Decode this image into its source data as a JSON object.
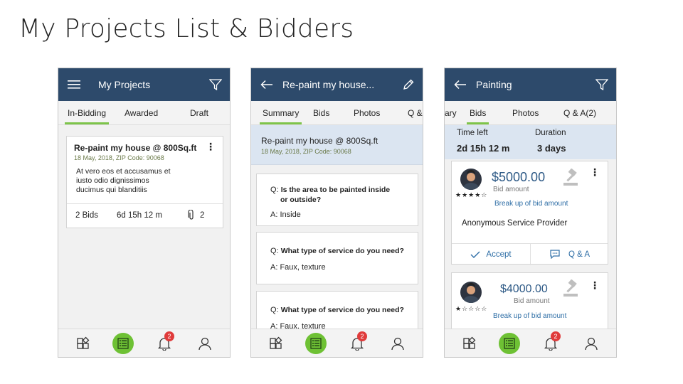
{
  "slide": {
    "title": "My Projects List & Bidders"
  },
  "screen1": {
    "appbar_title": "My Projects",
    "tabs": [
      "In-Bidding",
      "Awarded",
      "Draft"
    ],
    "card": {
      "title": "Re-paint  my house @ 800Sq.ft",
      "meta": "18 May, 2018, ZIP Code: 90068",
      "desc_line1": "At vero eos et accusamus et",
      "desc_line2": "iusto odio dignissimos",
      "desc_line3": "ducimus qui blanditiis",
      "bids": "2 Bids",
      "time": "6d 15h 12 m",
      "attachments": "2"
    },
    "notifications": "2"
  },
  "screen2": {
    "appbar_title": "Re-paint my house...",
    "tabs": [
      "Summary",
      "Bids",
      "Photos",
      "Q &"
    ],
    "header": {
      "title": "Re-paint  my house @ 800Sq.ft",
      "meta": "18 May, 2018, ZIP Code: 90068"
    },
    "qa": [
      {
        "q_prefix": "Q:",
        "q_line1": "Is the area to be painted  inside",
        "q_line2": "or outside?",
        "a": "A: Inside"
      },
      {
        "q_prefix": "Q:",
        "q_line1": "What type of service do you need?",
        "q_line2": "",
        "a": "A: Faux, texture"
      },
      {
        "q_prefix": "Q:",
        "q_line1": "What type of service do you need?",
        "q_line2": "",
        "a": "A: Faux, texture"
      }
    ],
    "notifications": "2"
  },
  "screen3": {
    "appbar_title": "Painting",
    "tabs": [
      "ary",
      "Bids",
      "Photos",
      "Q & A(2)"
    ],
    "info": {
      "time_label": "Time left",
      "time_value": "2d 15h 12 m",
      "duration_label": "Duration",
      "duration_value": "3 days"
    },
    "bids": [
      {
        "amount": "$5000.00",
        "amount_label": "Bid amount",
        "stars": "★★★★☆",
        "rating": 4,
        "breakup": "Break up of bid amount",
        "provider": "Anonymous Service Provider",
        "accept": "Accept",
        "qa": "Q & A"
      },
      {
        "amount": "$4000.00",
        "amount_label": "Bid amount",
        "stars": "★☆☆☆☆",
        "rating": 1,
        "breakup": "Break up of bid amount"
      }
    ],
    "notifications": "2"
  },
  "colors": {
    "appbar": "#2d4a6b",
    "accent_green": "#6ec134",
    "tab_underline": "#7dc44a",
    "badge": "#e03b3b",
    "link_blue": "#2e6ea6"
  }
}
